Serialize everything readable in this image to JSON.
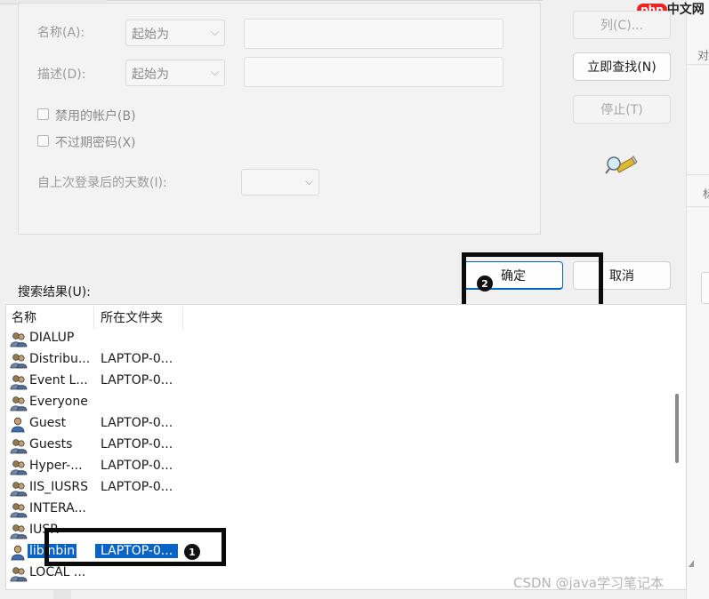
{
  "query": {
    "name_label": "名称(A):",
    "name_mode": "起始为",
    "desc_label": "描述(D):",
    "desc_mode": "起始为",
    "disabled_accounts": "禁用的帐户(B)",
    "non_expiring_pw": "不过期密码(X)",
    "days_since_logon": "自上次登录后的天数(I):"
  },
  "buttons": {
    "columns": "列(C)...",
    "find_now": "立即查找(N)",
    "stop": "停止(T)",
    "ok": "确定",
    "cancel": "取消"
  },
  "results": {
    "label": "搜索结果(U):",
    "col_name": "名称",
    "col_folder": "所在文件夹",
    "rows": [
      {
        "name": "DIALUP",
        "folder": "",
        "icon": "group-icon"
      },
      {
        "name": "Distribu...",
        "folder": "LAPTOP-0...",
        "icon": "group-icon"
      },
      {
        "name": "Event L...",
        "folder": "LAPTOP-0...",
        "icon": "group-icon"
      },
      {
        "name": "Everyone",
        "folder": "",
        "icon": "group-icon"
      },
      {
        "name": "Guest",
        "folder": "LAPTOP-0...",
        "icon": "user-icon"
      },
      {
        "name": "Guests",
        "folder": "LAPTOP-0...",
        "icon": "group-icon"
      },
      {
        "name": "Hyper-...",
        "folder": "LAPTOP-0...",
        "icon": "group-icon"
      },
      {
        "name": "IIS_IUSRS",
        "folder": "LAPTOP-0...",
        "icon": "group-icon"
      },
      {
        "name": "INTERA...",
        "folder": "",
        "icon": "group-icon"
      },
      {
        "name": "IUSR",
        "folder": "",
        "icon": "group-icon"
      },
      {
        "name": "libinbin",
        "folder": "LAPTOP-0...",
        "icon": "user-icon",
        "selected": true
      },
      {
        "name": "LOCAL ...",
        "folder": "",
        "icon": "group-icon"
      }
    ]
  },
  "annotations": {
    "step1": "1",
    "step2": "2"
  },
  "background": {
    "right_char1": "对",
    "right_char2": "标"
  },
  "watermark": "CSDN @java学习笔记本",
  "logo": "php中文网",
  "colors": {
    "selection": "#0a64c8",
    "accent_border": "#0067c0",
    "annotation": "#0b0b0b"
  }
}
